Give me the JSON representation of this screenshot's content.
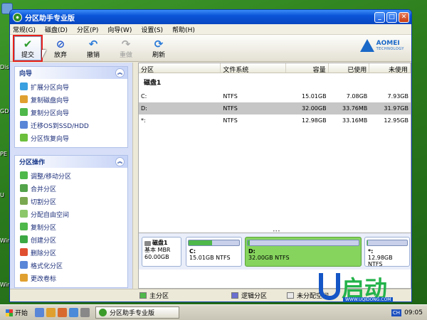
{
  "window": {
    "title": "分区助手专业版"
  },
  "menu": [
    "常规(G)",
    "磁盘(D)",
    "分区(P)",
    "向导(W)",
    "设置(S)",
    "帮助(H)"
  ],
  "toolbar": {
    "buttons": [
      {
        "label": "提交",
        "icon": "check-icon",
        "enabled": true,
        "selected": true
      },
      {
        "label": "放弃",
        "icon": "discard-icon",
        "enabled": true
      },
      {
        "label": "撤销",
        "icon": "undo-icon",
        "enabled": true
      },
      {
        "label": "重做",
        "icon": "redo-icon",
        "enabled": false
      },
      {
        "label": "刷新",
        "icon": "refresh-icon",
        "enabled": true
      }
    ],
    "logo": "AOMEI",
    "logo_sub": "TECHNOLOGY"
  },
  "wizard_panel": {
    "title": "向导",
    "items": [
      "扩展分区向导",
      "复制磁盘向导",
      "复制分区向导",
      "迁移OS到SSD/HDD",
      "分区恢复向导"
    ]
  },
  "ops_panel": {
    "title": "分区操作",
    "items": [
      "调整/移动分区",
      "合并分区",
      "切割分区",
      "分配自由空间",
      "复制分区",
      "创建分区",
      "删除分区",
      "格式化分区",
      "更改卷标"
    ]
  },
  "table": {
    "headers": [
      "分区",
      "文件系统",
      "容量",
      "已使用",
      "未使用"
    ],
    "disk_label": "磁盘1",
    "rows": [
      {
        "name": "C:",
        "fs": "NTFS",
        "cap": "15.01GB",
        "used": "7.08GB",
        "free": "7.93GB",
        "selected": false
      },
      {
        "name": "D:",
        "fs": "NTFS",
        "cap": "32.00GB",
        "used": "33.76MB",
        "free": "31.97GB",
        "selected": true
      },
      {
        "name": "*:",
        "fs": "NTFS",
        "cap": "12.98GB",
        "used": "33.16MB",
        "free": "12.95GB",
        "selected": false
      }
    ]
  },
  "diskmap": {
    "disk": {
      "name": "磁盘1",
      "type": "基本 MBR",
      "size": "60.00GB"
    },
    "parts": [
      {
        "name": "C:",
        "desc": "15.01GB NTFS",
        "used_ratio": 0.47
      },
      {
        "name": "D:",
        "desc": "32.00GB NTFS",
        "used_ratio": 0.01
      },
      {
        "name": "*:",
        "desc": "12.98GB NTFS",
        "used_ratio": 0.01
      }
    ]
  },
  "legend": [
    "主分区",
    "逻辑分区",
    "未分配空间"
  ],
  "desktop_labels": [
    "Dis",
    "GDI",
    "PE",
    "U",
    "Win",
    "Win"
  ],
  "taskbar": {
    "start": "开始",
    "task": "分区助手专业版",
    "ime": "CH",
    "time": "09:05"
  },
  "brand": {
    "text": "启动",
    "url": "WWW.UQIDONG.COM"
  },
  "colors": {
    "primary": "#4fb84a",
    "logical": "#6a6fd0",
    "unalloc": "#e8e8e8",
    "titlebar": "#0a55d8"
  }
}
